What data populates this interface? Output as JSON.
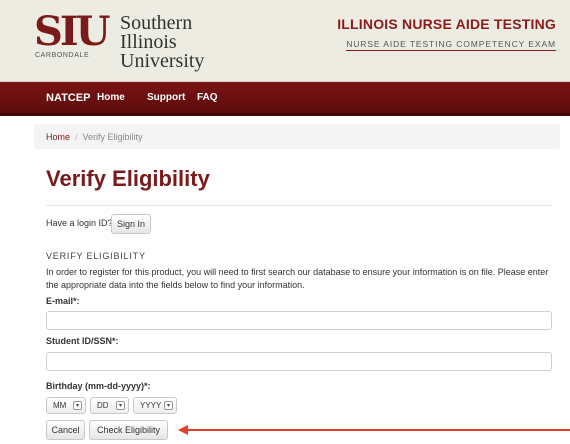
{
  "header": {
    "logo_mark": "SIU",
    "logo_sub": "CARBONDALE",
    "university_line1": "Southern Illinois",
    "university_line2": "University",
    "title": "ILLINOIS NURSE AIDE TESTING",
    "subtitle": "NURSE AIDE TESTING COMPETENCY EXAM"
  },
  "nav": {
    "items": [
      {
        "label": "NATCEP"
      },
      {
        "label": "Home"
      },
      {
        "label": "Support"
      },
      {
        "label": "FAQ"
      }
    ]
  },
  "breadcrumb": {
    "home": "Home",
    "separator": "/",
    "current": "Verify Eligibility"
  },
  "page": {
    "title": "Verify Eligibility"
  },
  "login": {
    "prompt": "Have a login ID?",
    "sign_in_label": "Sign In"
  },
  "form": {
    "section_heading": "VERIFY ELIGIBILITY",
    "intro": "In order to register for this product, you will need to first search our database to ensure your information is on file. Please enter the appropriate data into the fields below to find your information.",
    "email_label": "E-mail*:",
    "email_value": "",
    "student_id_label": "Student ID/SSN*:",
    "student_id_value": "",
    "birthday_label": "Birthday (mm-dd-yyyy)*:",
    "month_value": "MM",
    "day_value": "DD",
    "year_value": "YYYY",
    "cancel_label": "Cancel",
    "check_label": "Check Eligibility"
  },
  "colors": {
    "brand": "#7b1a1a",
    "nav_bg": "#6b1010",
    "annotation_arrow": "#e2402a"
  }
}
